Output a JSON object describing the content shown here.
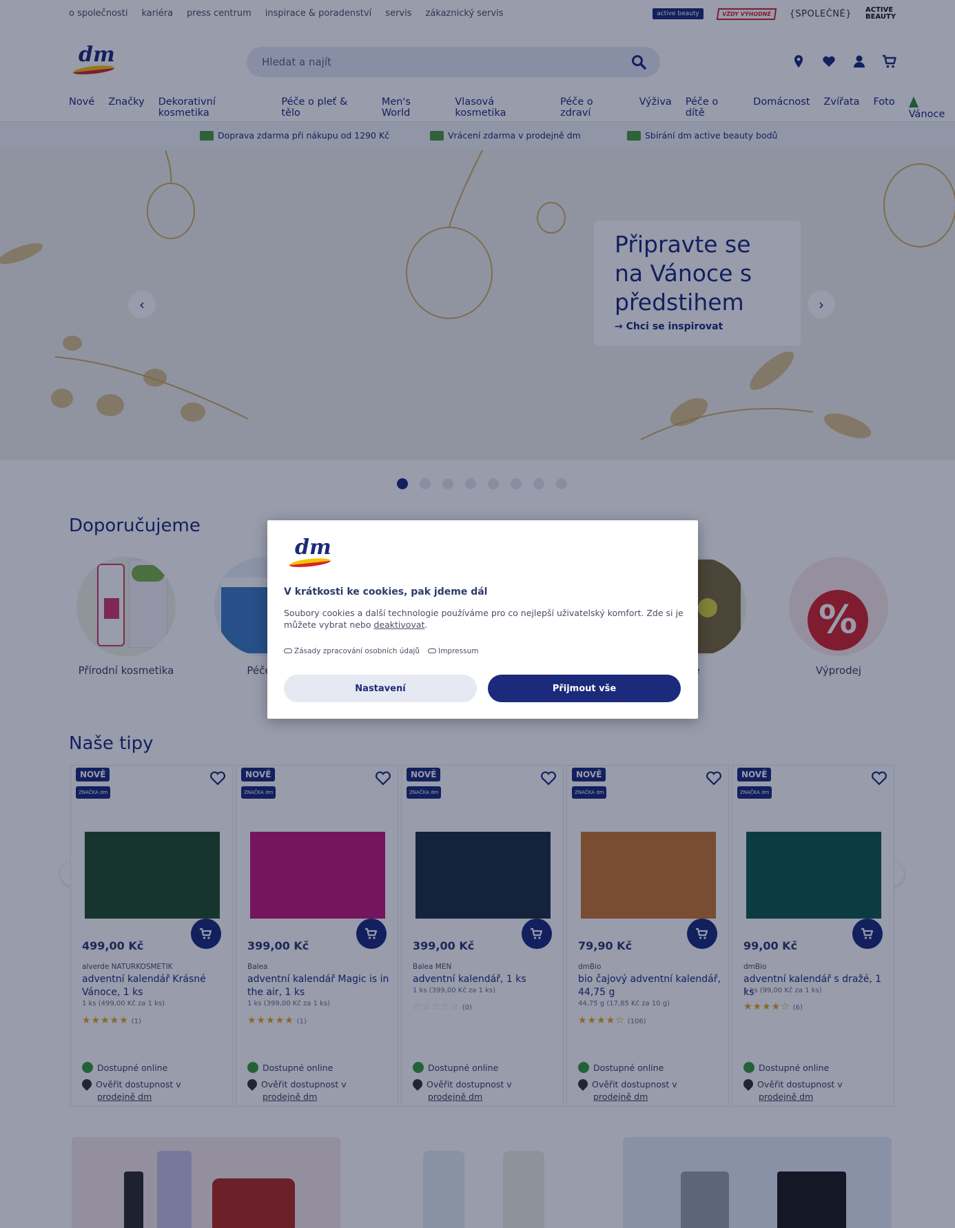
{
  "meta_links": [
    "o společnosti",
    "kariéra",
    "press centrum",
    "inspirace & poradenství",
    "servis",
    "zákaznický servis"
  ],
  "meta_brands": {
    "active_beauty": "active beauty",
    "vzdy_vyhodne": "VŽDY VÝHODNÉ",
    "spolecne": "{SPOLEČNÉ}",
    "active_beauty_logo": "ACTIVE BEAUTY"
  },
  "logo": "dm",
  "search": {
    "placeholder": "Hledat a najít"
  },
  "nav": [
    "Nové",
    "Značky",
    "Dekorativní kosmetika",
    "Péče o pleť & tělo",
    "Men's World",
    "Vlasová kosmetika",
    "Péče o zdraví",
    "Výživa",
    "Péče o dítě",
    "Domácnost",
    "Zvířata",
    "Foto",
    "Vánoce"
  ],
  "benefits": [
    "Doprava zdarma při nákupu od 1290 Kč",
    "Vrácení zdarma v prodejně dm",
    "Sbírání dm active beauty bodů"
  ],
  "hero": {
    "title": "Připravte se na Vánoce s předstihem",
    "link": "→ Chci se inspirovat",
    "prev": "‹",
    "next": "›",
    "slide_count": 8,
    "active_slide": 1
  },
  "recommend": {
    "heading": "Doporučujeme",
    "items": [
      {
        "label": "Přírodní kosmetika"
      },
      {
        "label": "Péče o"
      },
      {
        "label": "e"
      },
      {
        "label": "Výprodej"
      }
    ]
  },
  "tips": {
    "heading": "Naše tipy",
    "badge_new": "NOVĚ",
    "badge_brand": "ZNAČKA dm",
    "available": "Dostupné online",
    "store_check": "Ověřit dostupnost v",
    "store_link": "prodejně dm",
    "products": [
      {
        "price": "499,00 Kč",
        "brand": "alverde NATURKOSMETIK",
        "name": "adventní kalendář Krásné Vánoce, 1 ks",
        "unit": "1 ks (499,00 Kč za 1 ks)",
        "rating": 5,
        "stars": "★★★★★",
        "reviews": "(1)",
        "color": "#1f4f2a"
      },
      {
        "price": "399,00 Kč",
        "brand": "Balea",
        "name": "adventní kalendář Magic is in the air, 1 ks",
        "unit": "1 ks (399,00 Kč za 1 ks)",
        "rating": 5,
        "stars": "★★★★★",
        "reviews": "(1)",
        "color": "#c2187a"
      },
      {
        "price": "399,00 Kč",
        "brand": "Balea MEN",
        "name": "adventní kalendář, 1 ks",
        "unit": "1 ks (399,00 Kč za 1 ks)",
        "rating": 0,
        "stars": "☆☆☆☆☆",
        "reviews": "(0)",
        "color": "#1d2f3f"
      },
      {
        "price": "79,90 Kč",
        "brand": "dmBio",
        "name": "bio čajový adventní kalendář, 44,75 g",
        "unit": "44,75 g (17,85 Kč za 10 g)",
        "rating": 4.5,
        "stars": "★★★★☆",
        "reviews": "(106)",
        "color": "#c9772e"
      },
      {
        "price": "99,00 Kč",
        "brand": "dmBio",
        "name": "adventní kalendář s dražé, 1 ks",
        "unit": "1 ks (99,00 Kč za 1 ks)",
        "rating": 4,
        "stars": "★★★★☆",
        "reviews": "(6)",
        "color": "#0f5a4a"
      }
    ]
  },
  "cookie": {
    "logo": "dm",
    "title": "V krátkosti ke cookies, pak jdeme dál",
    "text": "Soubory cookies a další technologie používáme pro co nejlepší uživatelský komfort. Zde si je můžete vybrat nebo",
    "deactivate": "deaktivovat",
    "period": ".",
    "privacy": "Zásady zpracování osobních údajů",
    "impressum": "Impressum",
    "settings": "Nastavení",
    "accept": "Přijmout vše"
  },
  "colors": {
    "brand_blue": "#1b2a7a",
    "yellow": "#f5c400",
    "red": "#d6232b",
    "green": "#3a9a36",
    "star": "#e8a21c"
  }
}
